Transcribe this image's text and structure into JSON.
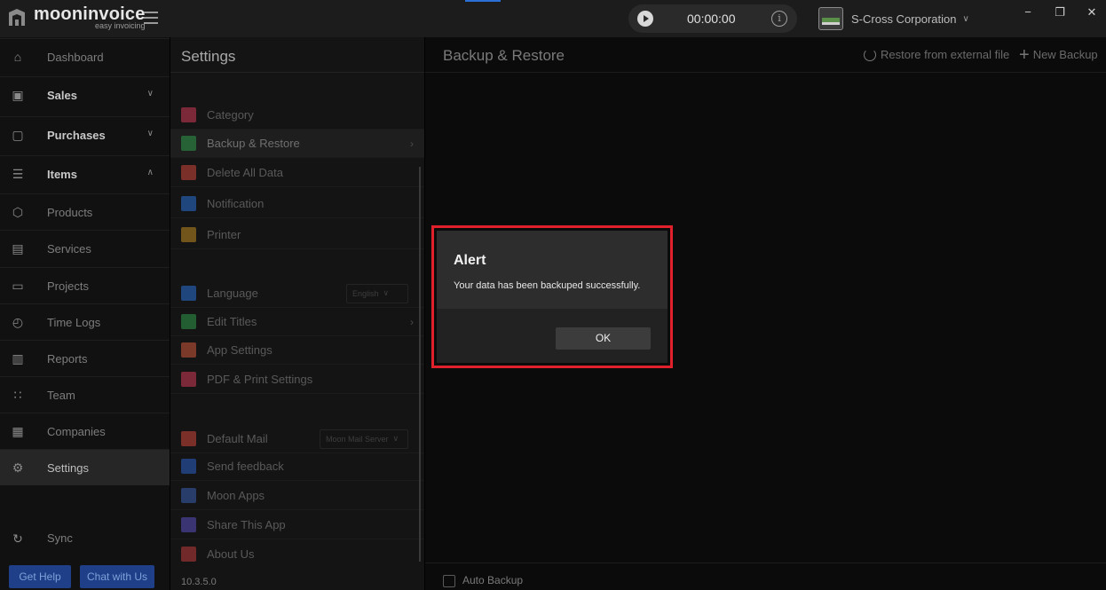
{
  "app": {
    "brand_name": "mooninvoice",
    "brand_tagline": "easy invoicing"
  },
  "timer": {
    "value": "00:00:00"
  },
  "company": {
    "name": "S-Cross Corporation"
  },
  "window_controls": {
    "minimize": "−",
    "maximize": "❐",
    "close": "✕"
  },
  "sidebar": {
    "items": [
      {
        "label": "Dashboard",
        "icon": "home-icon"
      },
      {
        "label": "Sales",
        "icon": "dollar-doc-icon"
      },
      {
        "label": "Purchases",
        "icon": "bag-icon"
      },
      {
        "label": "Items",
        "icon": "list-icon"
      },
      {
        "label": "Products",
        "icon": "box-icon"
      },
      {
        "label": "Services",
        "icon": "clipboard-icon"
      },
      {
        "label": "Projects",
        "icon": "folder-icon"
      },
      {
        "label": "Time Logs",
        "icon": "clock-icon"
      },
      {
        "label": "Reports",
        "icon": "chart-icon"
      },
      {
        "label": "Team",
        "icon": "team-icon"
      },
      {
        "label": "Companies",
        "icon": "building-icon"
      },
      {
        "label": "Settings",
        "icon": "gear-icon"
      },
      {
        "label": "Sync",
        "icon": "sync-icon"
      }
    ],
    "get_help": "Get Help",
    "chat": "Chat with Us"
  },
  "settings": {
    "title": "Settings",
    "items": [
      {
        "label": "Category",
        "color": "#d03a55"
      },
      {
        "label": "Backup & Restore",
        "color": "#2f9a4a"
      },
      {
        "label": "Delete All Data",
        "color": "#d0453a"
      },
      {
        "label": "Notification",
        "color": "#2a6fd6"
      },
      {
        "label": "Printer",
        "color": "#c08a20"
      },
      {
        "label": "Language",
        "color": "#2a6fd6",
        "value": "English"
      },
      {
        "label": "Edit Titles",
        "color": "#2f9a4a"
      },
      {
        "label": "App Settings",
        "color": "#d0573a"
      },
      {
        "label": "PDF & Print Settings",
        "color": "#d03a55"
      },
      {
        "label": "Default Mail",
        "color": "#d0453a",
        "value": "Moon Mail Server"
      },
      {
        "label": "Send feedback",
        "color": "#2a5fc6"
      },
      {
        "label": "Moon Apps",
        "color": "#3a5fb0"
      },
      {
        "label": "Share This App",
        "color": "#5a4fc0"
      },
      {
        "label": "About Us",
        "color": "#c03a3a"
      }
    ],
    "version": "10.3.5.0"
  },
  "main": {
    "title": "Backup & Restore",
    "restore_label": "Restore from external file",
    "new_backup_label": "New Backup",
    "auto_backup_label": "Auto Backup"
  },
  "dialog": {
    "title": "Alert",
    "message": "Your data has been backuped successfully.",
    "ok_label": "OK"
  }
}
